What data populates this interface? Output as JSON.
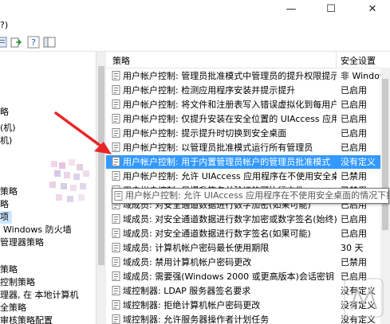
{
  "window": {
    "minimize_glyph": "—",
    "maximize_glyph": "☐",
    "close_glyph": "✕"
  },
  "menubar": {
    "help_label": "?)"
  },
  "tree": {
    "items": [
      "略",
      "(机)",
      "机)",
      "策略",
      "略",
      "项",
      "Windows 防火墙",
      "管理器策略",
      "策略",
      "控制策略",
      "理器, 在 本地计算机",
      "全策略",
      "审核策略配置"
    ]
  },
  "table": {
    "header_policy": "策略",
    "header_setting": "安全设置",
    "rows": [
      {
        "policy": "用户帐户控制: 管理员批准模式中管理员的提升权限提示的...",
        "setting": "非 Windows"
      },
      {
        "policy": "用户帐户控制: 检测应用程序安装并提示提升",
        "setting": "已启用"
      },
      {
        "policy": "用户帐户控制: 将文件和注册表写入错误虚拟化到每用户位置",
        "setting": "已启用"
      },
      {
        "policy": "用户帐户控制: 仅提升安装在安全位置的 UIAccess 应用程序",
        "setting": "已启用"
      },
      {
        "policy": "用户帐户控制: 提示提升时切换到安全桌面",
        "setting": "已启用"
      },
      {
        "policy": "用户帐户控制: 以管理员批准模式运行所有管理员",
        "setting": "已启用"
      },
      {
        "policy": "用户帐户控制: 用于内置管理员帐户的管理员批准模式",
        "setting": "没有定义"
      },
      {
        "policy": "用户帐户控制: 允许 UIAccess 应用程序在不使用安全桌面的情况下提升权限",
        "setting": "已禁用"
      },
      {
        "policy": "用户帐户控制: 只提升签名并验证的可执行文件",
        "setting": "已禁用"
      },
      {
        "policy": "域成员: 对安全通道数据进行数字加密(如果可能)",
        "setting": "已启用"
      },
      {
        "policy": "域成员: 对安全通道数据进行数字加密或数字签名(始终)",
        "setting": "已启用"
      },
      {
        "policy": "域成员: 对安全通道数据进行数字签名(如果可能)",
        "setting": "已启用"
      },
      {
        "policy": "域成员: 计算机帐户密码最长使用期限",
        "setting": "30 天"
      },
      {
        "policy": "域成员: 禁用计算机帐户密码更改",
        "setting": "已禁用"
      },
      {
        "policy": "域成员: 需要强(Windows 2000 或更高版本)会话密钥",
        "setting": "已启用"
      },
      {
        "policy": "域控制器: LDAP 服务器签名要求",
        "setting": "没有定义"
      },
      {
        "policy": "域控制器: 拒绝计算机帐户密码更改",
        "setting": "没有定义"
      },
      {
        "policy": "域控制器: 允许服务器操作者计划任务",
        "setting": "没有定义"
      }
    ],
    "selected_index": 6
  },
  "tooltip": {
    "text": "用户帐户控制: 允许 UIAccess 应用程序在不使用安全桌面的情况下提升权限"
  },
  "colors": {
    "selection": "#3399ff",
    "arrow": "#e8262a",
    "tree_selection": "#cce8ff"
  }
}
